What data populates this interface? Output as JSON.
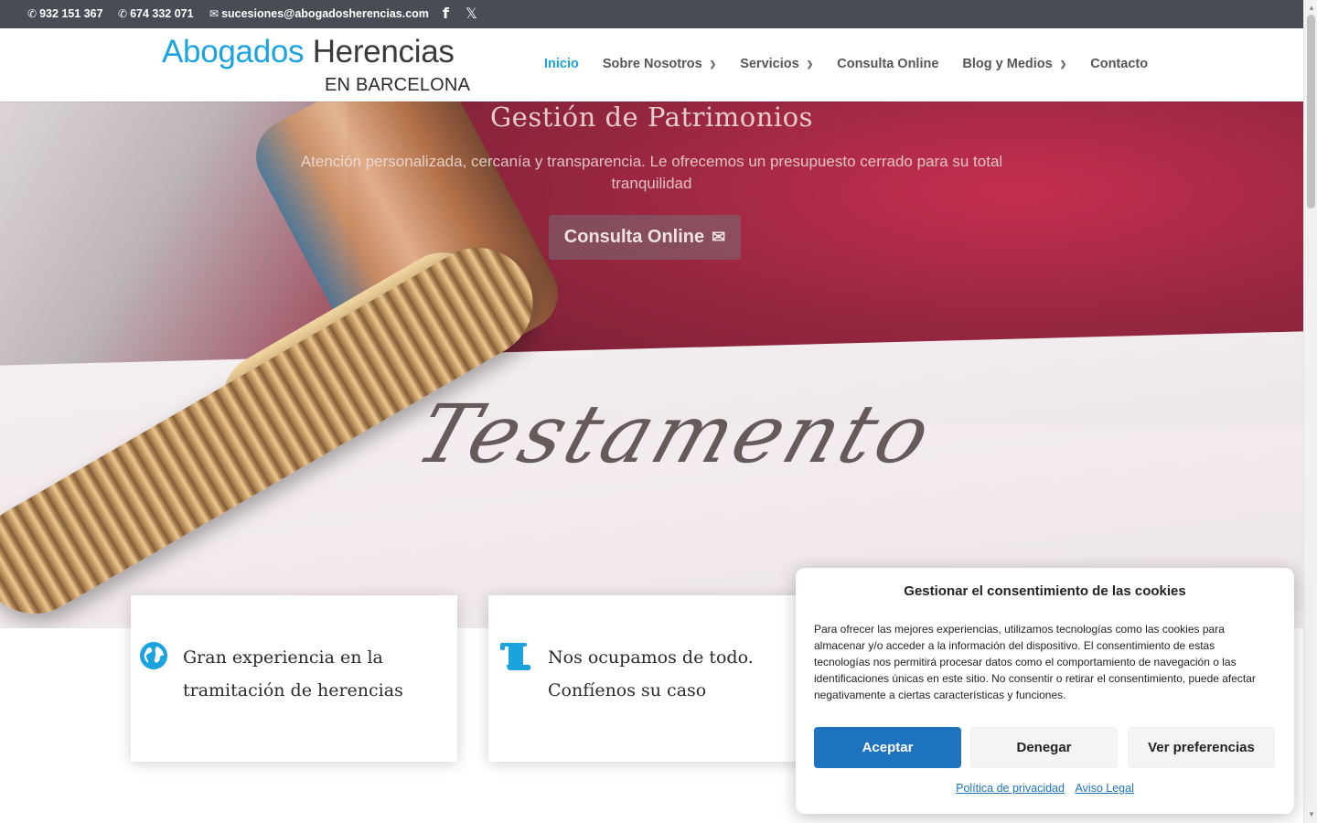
{
  "topbar": {
    "phone1": "932 151 367",
    "phone2": "674 332 071",
    "email": "sucesiones@abogadosherencias.com",
    "phone_icon": "phone-icon",
    "email_icon": "envelope-icon",
    "facebook_icon": "facebook-icon",
    "x_icon": "x-twitter-icon"
  },
  "logo": {
    "line1_a": "Abogados",
    "line1_b": "Herencias",
    "line2": "EN BARCELONA"
  },
  "nav": {
    "items": [
      {
        "label": "Inicio",
        "active": true,
        "dropdown": false
      },
      {
        "label": "Sobre Nosotros",
        "active": false,
        "dropdown": true
      },
      {
        "label": "Servicios",
        "active": false,
        "dropdown": true
      },
      {
        "label": "Consulta Online",
        "active": false,
        "dropdown": false
      },
      {
        "label": "Blog y Medios",
        "active": false,
        "dropdown": true
      },
      {
        "label": "Contacto",
        "active": false,
        "dropdown": false
      }
    ]
  },
  "hero": {
    "title": "Gestión de Patrimonios",
    "subtitle": "Atención personalizada, cercanía y transparencia. Le ofrecemos un presupuesto cerrado para su total tranquilidad",
    "button_label": "Consulta Online",
    "button_icon": "envelope-icon",
    "image_text": "Testamento"
  },
  "cards": [
    {
      "icon": "globe-icon",
      "text": "Gran experiencia en la tramitación de herencias"
    },
    {
      "icon": "scroll-icon",
      "text": "Nos ocupamos de todo. Confíenos su caso"
    }
  ],
  "cookie": {
    "title": "Gestionar el consentimiento de las cookies",
    "body": "Para ofrecer las mejores experiencias, utilizamos tecnologías como las cookies para almacenar y/o acceder a la información del dispositivo. El consentimiento de estas tecnologías nos permitirá procesar datos como el comportamiento de navegación o las identificaciones únicas en este sitio. No consentir o retirar el consentimiento, puede afectar negativamente a ciertas características y funciones.",
    "accept": "Aceptar",
    "deny": "Denegar",
    "prefs": "Ver preferencias",
    "privacy_link": "Política de privacidad",
    "legal_link": "Aviso Legal"
  },
  "colors": {
    "accent": "#1ba3e0",
    "topbar_bg": "#474c55",
    "accept_btn": "#1e73be"
  }
}
